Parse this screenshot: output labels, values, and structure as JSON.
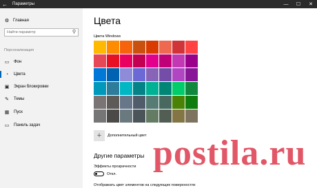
{
  "window": {
    "title": "Параметры",
    "back_glyph": "←",
    "minimize_glyph": "—",
    "maximize_glyph": "☐",
    "close_glyph": "✕"
  },
  "sidebar": {
    "home": {
      "label": "Главная",
      "icon": "gear-icon"
    },
    "search": {
      "placeholder": "Найти параметр",
      "icon": "search-icon"
    },
    "section": "Персонализация",
    "items": [
      {
        "label": "Фон",
        "icon": "image-icon"
      },
      {
        "label": "Цвета",
        "icon": "palette-icon",
        "active": true
      },
      {
        "label": "Экран блокировки",
        "icon": "monitor-icon"
      },
      {
        "label": "Темы",
        "icon": "brush-icon"
      },
      {
        "label": "Пуск",
        "icon": "start-icon"
      },
      {
        "label": "Панель задач",
        "icon": "taskbar-icon"
      }
    ],
    "active_accent": "#0063b1"
  },
  "main": {
    "title": "Цвета",
    "grid_label": "Цвета Windows",
    "swatches": [
      "#ffb900",
      "#ff8c00",
      "#f7630c",
      "#ca5010",
      "#da3b01",
      "#ef6950",
      "#d13438",
      "#ff4343",
      "#e74856",
      "#e81123",
      "#ea005e",
      "#c30052",
      "#e3008c",
      "#bf0077",
      "#c239b3",
      "#9a0089",
      "#0078d7",
      "#0063b1",
      "#8e8cd8",
      "#6b69d6",
      "#8764b8",
      "#744da9",
      "#b146c2",
      "#881798",
      "#0099bc",
      "#2d7d9a",
      "#00b7c3",
      "#038387",
      "#00b294",
      "#018574",
      "#00cc6a",
      "#10893e",
      "#7a7574",
      "#5d5a58",
      "#68768a",
      "#515c6b",
      "#567c73",
      "#486860",
      "#498205",
      "#107c10",
      "#767676",
      "#4c4a48",
      "#69797e",
      "#4a5459",
      "#647c64",
      "#525e54",
      "#847545",
      "#7e735f"
    ],
    "add_color": {
      "label": "Дополнительный цвет",
      "plus": "+"
    },
    "other_title": "Другие параметры",
    "transparency": {
      "label": "Эффекты прозрачности",
      "state": "Откл.",
      "on": false
    },
    "surfaces_label": "Отображать цвет элементов на следующих поверхностях"
  },
  "watermark": {
    "text": "postila.ru",
    "color": "#dc3246"
  }
}
